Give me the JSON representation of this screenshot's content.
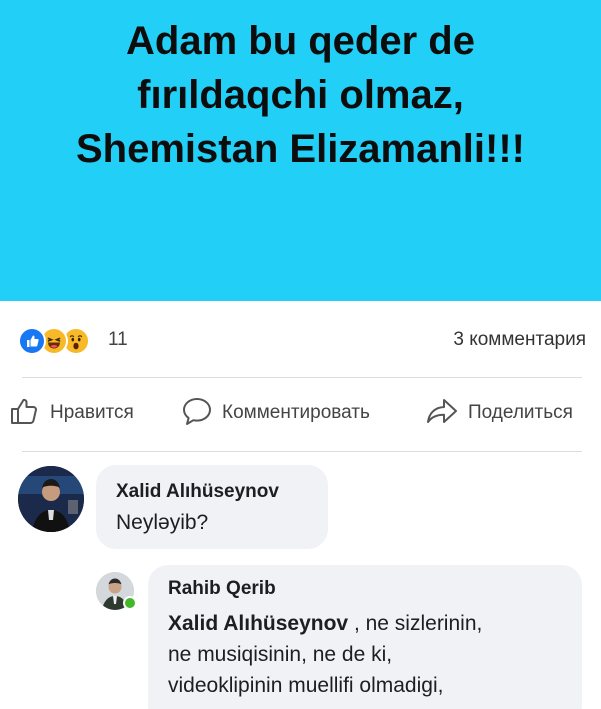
{
  "banner": {
    "lines": [
      "Adam bu qeder de",
      "fırıldaqchi olmaz,",
      "Shemistan Elizamanli!!!"
    ],
    "background": "#22d0f7"
  },
  "stats": {
    "reactions": [
      "like-icon",
      "haha-icon",
      "wow-icon"
    ],
    "reaction_count": "11",
    "comments_count": "3 комментария"
  },
  "actions": {
    "like_label": "Нравится",
    "comment_label": "Комментировать",
    "share_label": "Поделиться"
  },
  "comments": [
    {
      "author": "Xalid Alıhüseynov",
      "text": "Neyləyib?"
    },
    {
      "author": "Rahib Qerib",
      "mention": "Xalid Alıhüseynov",
      "text_lines": [
        " , ne sizlerinin,",
        "ne musiqisinin, ne de ki,",
        "videoklipinin muellifi olmadigi,"
      ]
    }
  ],
  "colors": {
    "accent_blue": "#1877f2",
    "online_green": "#42b72a",
    "bubble_bg": "#f0f2f5"
  }
}
